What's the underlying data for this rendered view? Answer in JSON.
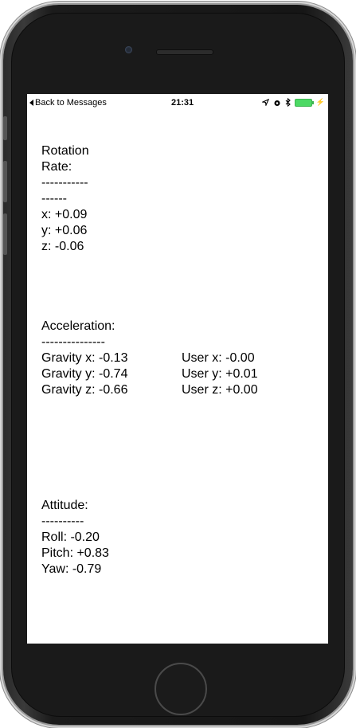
{
  "status_bar": {
    "back_label": "Back to Messages",
    "time": "21:31",
    "icons": [
      "location-arrow-icon",
      "alarm-icon",
      "bluetooth-icon",
      "battery-charging-icon"
    ],
    "battery_color": "#4cd964"
  },
  "rotation_rate": {
    "title": "Rotation Rate:",
    "divider": "-----------------",
    "x": "x: +0.09",
    "y": "y: +0.06",
    "z": "z: -0.06"
  },
  "acceleration": {
    "title": "Acceleration:",
    "divider": "---------------",
    "gravity_x": "Gravity x: -0.13",
    "gravity_y": "Gravity y: -0.74",
    "gravity_z": "Gravity z: -0.66",
    "user_x": "User x: -0.00",
    "user_y": "User y: +0.01",
    "user_z": "User z: +0.00"
  },
  "attitude": {
    "title": "Attitude:",
    "divider": "----------",
    "roll": "Roll: -0.20",
    "pitch": "Pitch: +0.83",
    "yaw": "Yaw: -0.79"
  }
}
